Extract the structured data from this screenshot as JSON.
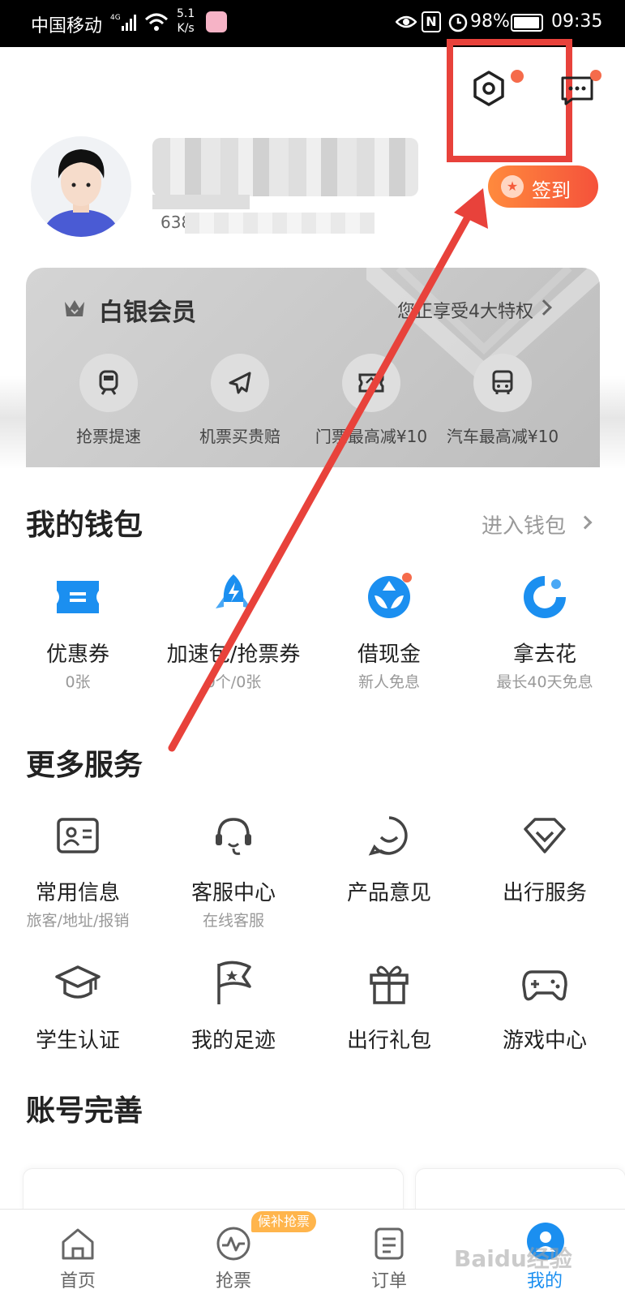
{
  "status_bar": {
    "carrier": "中国移动",
    "network": "4G",
    "speed_value": "5.1",
    "speed_unit": "K/s",
    "nfc": "N",
    "battery": "98%",
    "battery_level": 0.98,
    "time": "09:35"
  },
  "header": {
    "phone_prefix": "638",
    "signin_label": "签到"
  },
  "member": {
    "title": "白银会员",
    "privilege_text": "您正享受4大特权",
    "items": [
      {
        "label": "抢票提速",
        "icon": "train-icon"
      },
      {
        "label": "机票买贵赔",
        "icon": "plane-icon"
      },
      {
        "label": "门票最高减¥10",
        "icon": "ticket-icon"
      },
      {
        "label": "汽车最高减¥10",
        "icon": "bus-icon"
      }
    ]
  },
  "wallet": {
    "title": "我的钱包",
    "link": "进入钱包",
    "items": [
      {
        "label": "优惠券",
        "sub": "0张",
        "icon": "coupon-icon"
      },
      {
        "label": "加速包/抢票券",
        "sub": "0个/0张",
        "icon": "rocket-icon"
      },
      {
        "label": "借现金",
        "sub": "新人免息",
        "icon": "cash-icon"
      },
      {
        "label": "拿去花",
        "sub": "最长40天免息",
        "icon": "naquhua-icon"
      }
    ]
  },
  "services": {
    "title": "更多服务",
    "items": [
      {
        "label": "常用信息",
        "sub": "旅客/地址/报销",
        "icon": "id-card-icon"
      },
      {
        "label": "客服中心",
        "sub": "在线客服",
        "icon": "headset-icon"
      },
      {
        "label": "产品意见",
        "sub": "",
        "icon": "feedback-icon"
      },
      {
        "label": "出行服务",
        "sub": "",
        "icon": "diamond-icon"
      },
      {
        "label": "学生认证",
        "sub": "",
        "icon": "graduation-cap-icon"
      },
      {
        "label": "我的足迹",
        "sub": "",
        "icon": "flag-icon"
      },
      {
        "label": "出行礼包",
        "sub": "",
        "icon": "gift-icon"
      },
      {
        "label": "游戏中心",
        "sub": "",
        "icon": "gamepad-icon"
      }
    ]
  },
  "account": {
    "title": "账号完善"
  },
  "bottom_nav": {
    "items": [
      {
        "label": "首页",
        "icon": "home-icon"
      },
      {
        "label": "抢票",
        "icon": "pulse-icon",
        "badge": "候补抢票"
      },
      {
        "label": "订单",
        "icon": "order-icon"
      },
      {
        "label": "我的",
        "icon": "profile-icon",
        "active": true
      }
    ]
  },
  "watermark": "Baidu经验",
  "colors": {
    "accent_blue": "#1b8ff0",
    "signin_gradient_start": "#ff8a3d",
    "signin_gradient_end": "#f5523b",
    "annotation_red": "#e8423b",
    "badge_orange": "#ffb54c"
  }
}
